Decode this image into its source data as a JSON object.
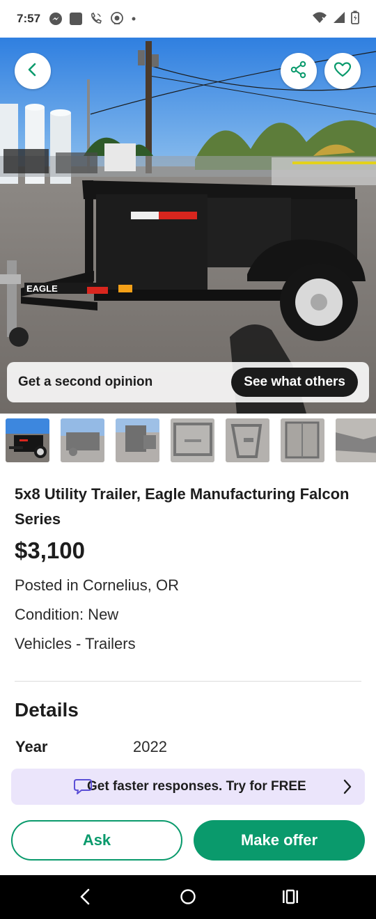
{
  "status_bar": {
    "time": "7:57",
    "left_icons": [
      "messenger-icon",
      "square-app-icon",
      "wifi-call-icon",
      "globe-app-icon",
      "dot-icon"
    ],
    "right_icons": [
      "wifi-icon",
      "signal-icon",
      "battery-icon"
    ]
  },
  "hero": {
    "brand_text": "EAGLE",
    "opinion_text": "Get a second opinion",
    "opinion_button": "See what others"
  },
  "thumbnails": [
    {
      "name": "photo-1",
      "selected": true
    },
    {
      "name": "photo-2",
      "selected": false
    },
    {
      "name": "photo-3",
      "selected": false
    },
    {
      "name": "photo-4",
      "selected": false
    },
    {
      "name": "photo-5",
      "selected": false
    },
    {
      "name": "photo-6",
      "selected": false
    },
    {
      "name": "photo-7",
      "selected": false
    }
  ],
  "listing": {
    "title": "5x8 Utility Trailer, Eagle Manufacturing Falcon Series",
    "price": "$3,100",
    "location": "Posted in Cornelius, OR",
    "condition": "Condition: New",
    "category": "Vehicles - Trailers"
  },
  "details": {
    "heading": "Details",
    "rows": [
      {
        "label": "Year",
        "value": "2022"
      }
    ]
  },
  "promo": {
    "text": "Get faster responses. Try for FREE"
  },
  "actions": {
    "ask_label": "Ask",
    "offer_label": "Make offer"
  },
  "colors": {
    "accent_green": "#0a9a6c",
    "promo_bg": "#ebe5fb",
    "promo_icon": "#5b4fd6"
  }
}
